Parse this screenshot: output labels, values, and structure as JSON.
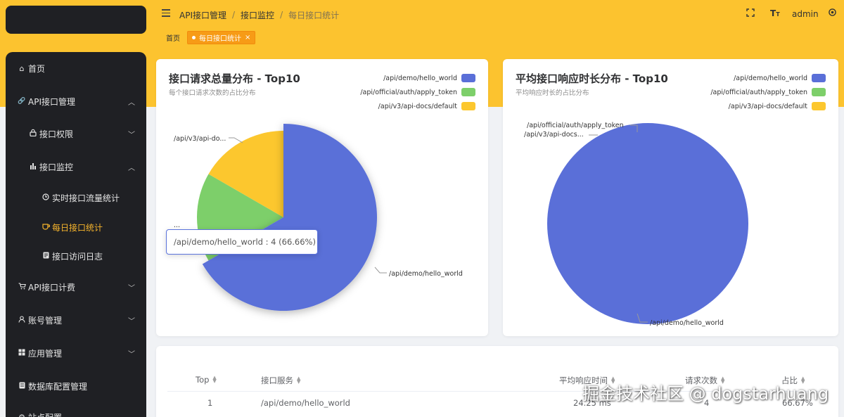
{
  "colors": {
    "accent": "#fcc32f",
    "active_tag": "#f79b16",
    "blue": "#5a6fd8",
    "green": "#7dcf6a",
    "yellow": "#fcc72e",
    "sidebar": "#1f2024"
  },
  "header": {
    "breadcrumb": [
      "API接口管理",
      "接口监控",
      "每日接口统计"
    ],
    "separator": "/",
    "user": "admin",
    "icons": [
      "menu-fold-icon",
      "fullscreen-icon",
      "font-size-icon",
      "settings-icon"
    ]
  },
  "tags": {
    "home": "首页",
    "active": "每日接口统计",
    "close": "×"
  },
  "sidebar": {
    "items": [
      {
        "label": "首页",
        "icon": "⌂"
      },
      {
        "label": "API接口管理",
        "icon": "🔗",
        "chev": "⌃"
      },
      {
        "label": "接口权限",
        "icon": "🔒",
        "chev": "⌄"
      },
      {
        "label": "接口监控",
        "icon": "📊",
        "chev": "⌃"
      },
      {
        "label": "实时接口流量统计",
        "icon": "◷"
      },
      {
        "label": "每日接口统计",
        "icon": "☕"
      },
      {
        "label": "接口访问日志",
        "icon": "▦"
      },
      {
        "label": "API接口计费",
        "icon": "🛒",
        "chev": "⌄"
      },
      {
        "label": "账号管理",
        "icon": "👤",
        "chev": "⌄"
      },
      {
        "label": "应用管理",
        "icon": "▦",
        "chev": "⌄"
      },
      {
        "label": "数据库配置管理",
        "icon": "🗄"
      },
      {
        "label": "站点配置",
        "icon": "⚙"
      }
    ]
  },
  "card1": {
    "title": "接口请求总量分布 - Top10",
    "subtitle": "每个接口请求次数的占比分布",
    "tooltip": "/api/demo/hello_world : 4 (66.66%)",
    "labels": {
      "hello": "/api/demo/hello_world",
      "docs": "/api/v3/api-do...",
      "auth": "..."
    }
  },
  "card2": {
    "title": "平均接口响应时长分布 - Top10",
    "subtitle": "平均响应时长的占比分布",
    "labels": {
      "auth": "/api/official/auth/apply_token",
      "docs": "/api/v3/api-docs...",
      "hello": "/api/demo/hello_world"
    }
  },
  "legend": [
    {
      "name": "/api/demo/hello_world",
      "color": "#5a6fd8"
    },
    {
      "name": "/api/official/auth/apply_token",
      "color": "#7dcf6a"
    },
    {
      "name": "/api/v3/api-docs/default",
      "color": "#fcc72e"
    }
  ],
  "chart_data": [
    {
      "type": "pie",
      "title": "接口请求总量分布 - Top10",
      "subtitle": "每个接口请求次数的占比分布",
      "categories": [
        "/api/demo/hello_world",
        "/api/official/auth/apply_token",
        "/api/v3/api-docs/default"
      ],
      "values": [
        4,
        1,
        1
      ],
      "percentages": [
        66.66,
        16.67,
        16.67
      ],
      "legend": "top-right"
    },
    {
      "type": "pie",
      "title": "平均接口响应时长分布 - Top10",
      "subtitle": "平均响应时长的占比分布",
      "categories": [
        "/api/demo/hello_world",
        "/api/official/auth/apply_token",
        "/api/v3/api-docs/default"
      ],
      "values": [
        24.25,
        0,
        0
      ],
      "legend": "top-right"
    }
  ],
  "table": {
    "headers": [
      "Top",
      "接口服务",
      "平均响应时间",
      "请求次数",
      "占比"
    ],
    "rows": [
      [
        "1",
        "/api/demo/hello_world",
        "24.25 ms",
        "4",
        "66.67%"
      ]
    ]
  },
  "watermark": "掘金技术社区 @ dogstarhuang"
}
